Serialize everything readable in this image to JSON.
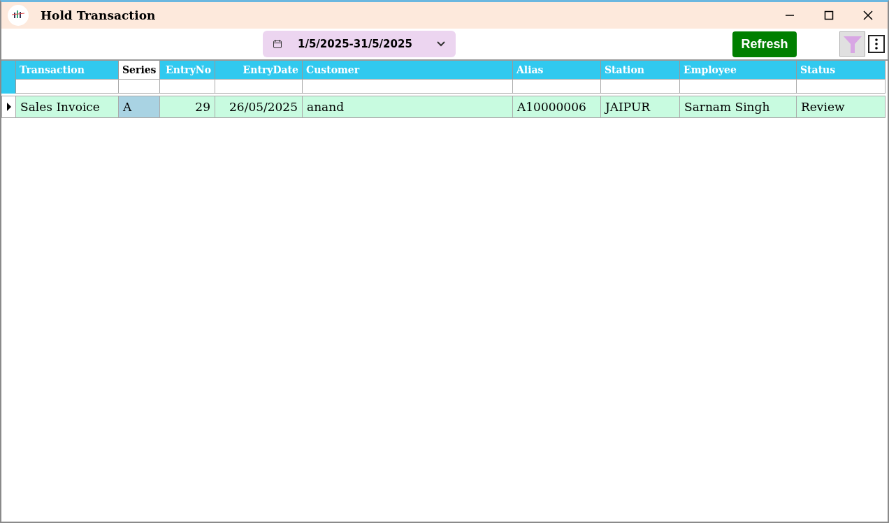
{
  "window": {
    "title": "Hold Transaction"
  },
  "toolbar": {
    "date_range": "1/5/2025-31/5/2025",
    "refresh": "Refresh",
    "filter_active": true
  },
  "table": {
    "columns": [
      {
        "label": "Transaction",
        "selected": false,
        "kind": "text"
      },
      {
        "label": "Series",
        "selected": true,
        "kind": "text"
      },
      {
        "label": "EntryNo",
        "selected": false,
        "kind": "number"
      },
      {
        "label": "EntryDate",
        "selected": false,
        "kind": "number"
      },
      {
        "label": "Customer",
        "selected": false,
        "kind": "text"
      },
      {
        "label": "Alias",
        "selected": false,
        "kind": "text"
      },
      {
        "label": "Station",
        "selected": false,
        "kind": "text"
      },
      {
        "label": "Employee",
        "selected": false,
        "kind": "text"
      },
      {
        "label": "Status",
        "selected": false,
        "kind": "text"
      }
    ],
    "rows": [
      {
        "current": true,
        "cells": [
          "Sales Invoice",
          "A",
          "29",
          "26/05/2025",
          "anand",
          "A10000006",
          "JAIPUR",
          "Sarnam Singh",
          "Review"
        ]
      }
    ]
  }
}
